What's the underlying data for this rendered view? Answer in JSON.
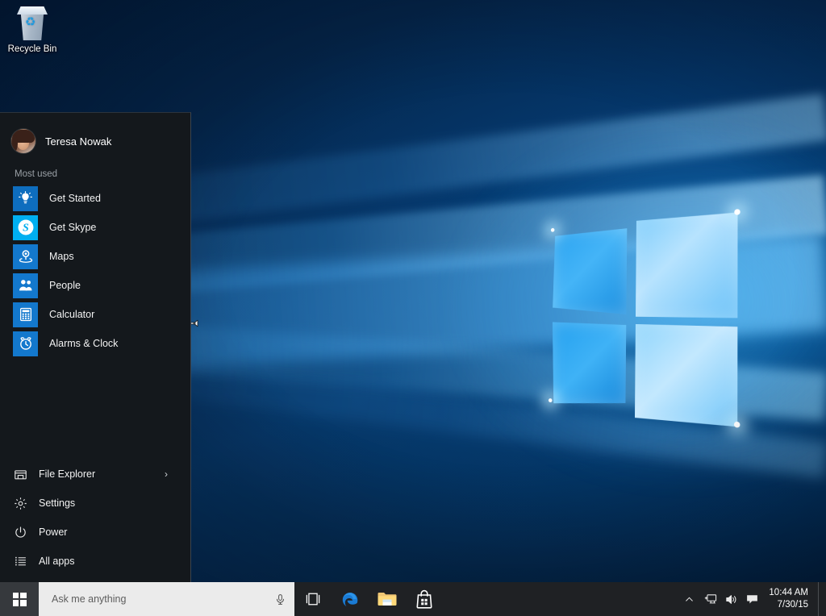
{
  "desktop": {
    "icons": [
      {
        "name": "recycle-bin",
        "label": "Recycle Bin",
        "icon": "recycle-bin-icon"
      }
    ],
    "wallpaper": "windows-10-hero-blue-window",
    "cursor": "horizontal-resize-cursor"
  },
  "start_menu": {
    "user": {
      "name": "Teresa Nowak",
      "avatar": "user-avatar-photo"
    },
    "most_used_label": "Most used",
    "most_used": [
      {
        "label": "Get Started",
        "icon": "lightbulb-icon",
        "color": "#0e6dbe"
      },
      {
        "label": "Get Skype",
        "icon": "skype-icon",
        "color": "#00aff0"
      },
      {
        "label": "Maps",
        "icon": "map-pin-icon",
        "color": "#1378cd"
      },
      {
        "label": "People",
        "icon": "people-icon",
        "color": "#1378cd"
      },
      {
        "label": "Calculator",
        "icon": "calculator-icon",
        "color": "#1378cd"
      },
      {
        "label": "Alarms & Clock",
        "icon": "alarm-clock-icon",
        "color": "#1378cd"
      }
    ],
    "bottom_items": [
      {
        "label": "File Explorer",
        "icon": "folder-icon",
        "chevron": "›"
      },
      {
        "label": "Settings",
        "icon": "gear-icon",
        "chevron": ""
      },
      {
        "label": "Power",
        "icon": "power-icon",
        "chevron": ""
      },
      {
        "label": "All apps",
        "icon": "list-icon",
        "chevron": ""
      }
    ]
  },
  "taskbar": {
    "start_button": {
      "label": "Start",
      "icon": "windows-logo-icon"
    },
    "search": {
      "placeholder": "Ask me anything",
      "value": "",
      "mic_icon": "microphone-icon"
    },
    "buttons": [
      {
        "label": "Task View",
        "icon": "task-view-icon"
      },
      {
        "label": "Microsoft Edge",
        "icon": "edge-icon"
      },
      {
        "label": "File Explorer",
        "icon": "file-explorer-icon"
      },
      {
        "label": "Store",
        "icon": "store-icon"
      }
    ],
    "tray": [
      {
        "label": "Show hidden icons",
        "icon": "chevron-up-icon"
      },
      {
        "label": "Network",
        "icon": "network-icon"
      },
      {
        "label": "Volume",
        "icon": "speaker-icon"
      },
      {
        "label": "Action Center",
        "icon": "action-center-icon"
      }
    ],
    "clock": {
      "time": "10:44 AM",
      "date": "7/30/15"
    }
  },
  "colors": {
    "taskbar_bg": "#1f2124",
    "start_menu_bg": "#14181c",
    "accent": "#0078d7",
    "search_bg": "#ebebeb"
  }
}
